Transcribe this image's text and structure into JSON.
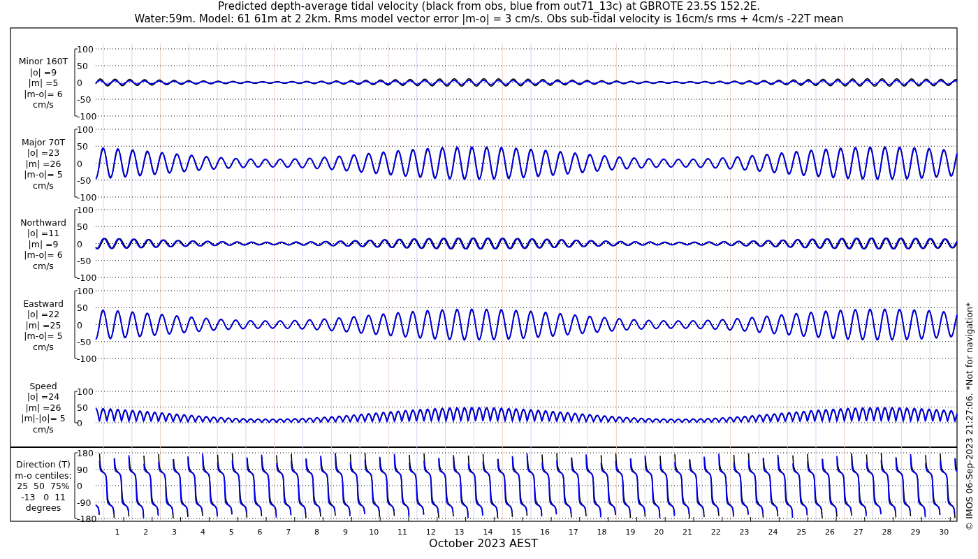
{
  "title_lines": [
    "Predicted depth-average tidal velocity (black from obs, blue from out71_13c) at GBROTE 23.5S 152.2E.",
    "Water:59m. Model: 61 61m at 2 2km. Rms model vector error |m-o| = 3 cm/s. Obs sub-tidal velocity is 16cm/s rms + 4cm/s -22T mean"
  ],
  "panels": [
    {
      "kind": "minor",
      "label_lines": [
        "Minor 160T",
        "|o| =9",
        "|m| =5",
        "|m-o|= 6",
        "cm/s"
      ],
      "yticks": [
        "100",
        "50",
        "0",
        "-50",
        "-100"
      ]
    },
    {
      "kind": "major",
      "label_lines": [
        "Major 70T",
        "|o| =23",
        "|m| =26",
        "|m-o|= 5",
        "cm/s"
      ],
      "yticks": [
        "100",
        "50",
        "0",
        "-50",
        "-100"
      ]
    },
    {
      "kind": "north",
      "label_lines": [
        "Northward",
        "|o| =11",
        "|m| =9",
        "|m-o|= 6",
        "cm/s"
      ],
      "yticks": [
        "100",
        "50",
        "0",
        "-50",
        "-100"
      ]
    },
    {
      "kind": "east",
      "label_lines": [
        "Eastward",
        "|o| =22",
        "|m| =25",
        "|m-o|= 5",
        "cm/s"
      ],
      "yticks": [
        "100",
        "50",
        "0",
        "-50",
        "-100"
      ]
    },
    {
      "kind": "speed",
      "label_lines": [
        "Speed",
        "|o| =24",
        "|m| =26",
        "|m|-|o|= 5",
        "cm/s"
      ],
      "yticks": [
        "100",
        "50",
        "0"
      ]
    },
    {
      "kind": "direction",
      "label_lines": [
        "Direction (T)",
        "m-o centiles:",
        "25  50  75%",
        "-13   0  11",
        "degrees"
      ],
      "yticks": [
        "180",
        "90",
        "0",
        "-90",
        "-180"
      ]
    }
  ],
  "x_axis": {
    "day_labels": [
      "1",
      "2",
      "3",
      "4",
      "5",
      "6",
      "7",
      "8",
      "9",
      "10",
      "11",
      "12",
      "13",
      "14",
      "15",
      "16",
      "17",
      "18",
      "19",
      "20",
      "21",
      "22",
      "23",
      "24",
      "25",
      "26",
      "27",
      "28",
      "29",
      "30"
    ],
    "label": "October 2023 AEST"
  },
  "copyright": "© IMOS 06-Sep-2023 21:27:06. *Not for navigation*"
}
